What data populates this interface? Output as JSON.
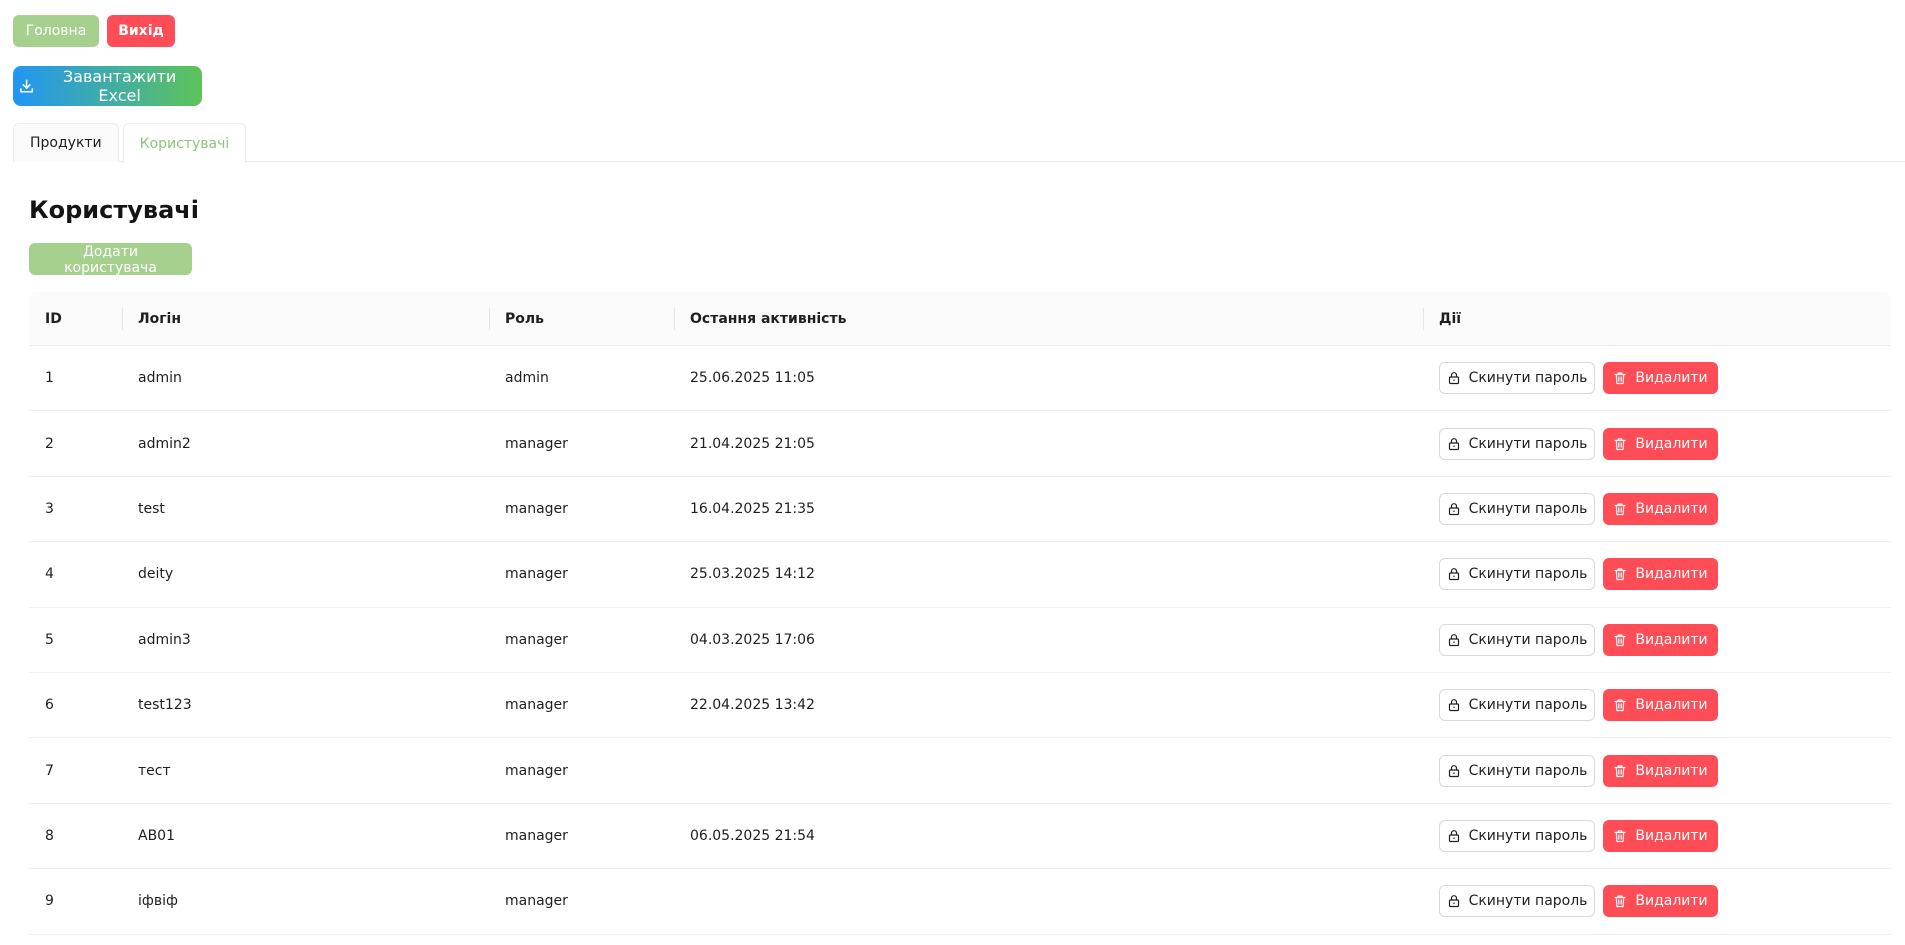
{
  "header": {
    "home_label": "Головна",
    "exit_label": "Вихід",
    "excel_label": "Завантажити Excel",
    "excel_icon": "download-icon"
  },
  "tabs": [
    {
      "label": "Продукти",
      "active": false
    },
    {
      "label": "Користувачі",
      "active": true
    }
  ],
  "section": {
    "title": "Користувачі",
    "add_label": "Додати користувача"
  },
  "table": {
    "columns": [
      "ID",
      "Логін",
      "Роль",
      "Остання активність",
      "Дії"
    ],
    "reset_label": "Скинути пароль",
    "reset_icon": "lock-icon",
    "delete_label": "Видалити",
    "delete_icon": "trash-icon",
    "rows": [
      {
        "id": "1",
        "login": "admin",
        "role": "admin",
        "activity": "25.06.2025 11:05"
      },
      {
        "id": "2",
        "login": "admin2",
        "role": "manager",
        "activity": "21.04.2025 21:05"
      },
      {
        "id": "3",
        "login": "test",
        "role": "manager",
        "activity": "16.04.2025 21:35"
      },
      {
        "id": "4",
        "login": "deity",
        "role": "manager",
        "activity": "25.03.2025 14:12"
      },
      {
        "id": "5",
        "login": "admin3",
        "role": "manager",
        "activity": "04.03.2025 17:06"
      },
      {
        "id": "6",
        "login": "test123",
        "role": "manager",
        "activity": "22.04.2025 13:42"
      },
      {
        "id": "7",
        "login": "тест",
        "role": "manager",
        "activity": ""
      },
      {
        "id": "8",
        "login": "AB01",
        "role": "manager",
        "activity": "06.05.2025 21:54"
      },
      {
        "id": "9",
        "login": "іфвіф",
        "role": "manager",
        "activity": ""
      }
    ]
  },
  "colors": {
    "accent_green": "#a6d08e",
    "danger_red": "#ff4d57",
    "excel_gradient_start": "#2196f3",
    "excel_gradient_end": "#5ec35a",
    "active_tab_text": "#8bc57a"
  }
}
